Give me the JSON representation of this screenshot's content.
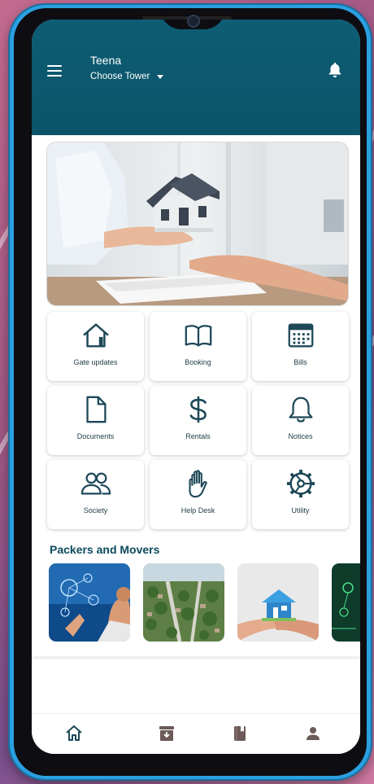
{
  "header": {
    "user_name": "Teena",
    "tower_label": "Choose Tower",
    "background_color": "#0b5469"
  },
  "hero": {
    "icon": "house-handover-image"
  },
  "features": [
    {
      "label": "Gate updates",
      "icon": "home-icon"
    },
    {
      "label": "Booking",
      "icon": "book-open-icon"
    },
    {
      "label": "Bills",
      "icon": "calendar-icon"
    },
    {
      "label": "Documents",
      "icon": "document-icon"
    },
    {
      "label": "Rentals",
      "icon": "dollar-icon"
    },
    {
      "label": "Notices",
      "icon": "bell-icon"
    },
    {
      "label": "Society",
      "icon": "users-icon"
    },
    {
      "label": "Help Desk",
      "icon": "hand-icon"
    },
    {
      "label": "Utility",
      "icon": "settings-icon"
    }
  ],
  "packers": {
    "title": "Packers and Movers",
    "thumbnails": [
      "tech-network-thumbnail",
      "aerial-neighborhood-thumbnail",
      "house-handover-thumbnail",
      "digital-circuit-thumbnail"
    ]
  },
  "bottom_nav": [
    "home-icon",
    "archive-icon",
    "book-icon",
    "profile-icon"
  ],
  "colors": {
    "accent": "#0b5469",
    "icon": "#1d4858",
    "nav_icon": "#6b5a57"
  }
}
